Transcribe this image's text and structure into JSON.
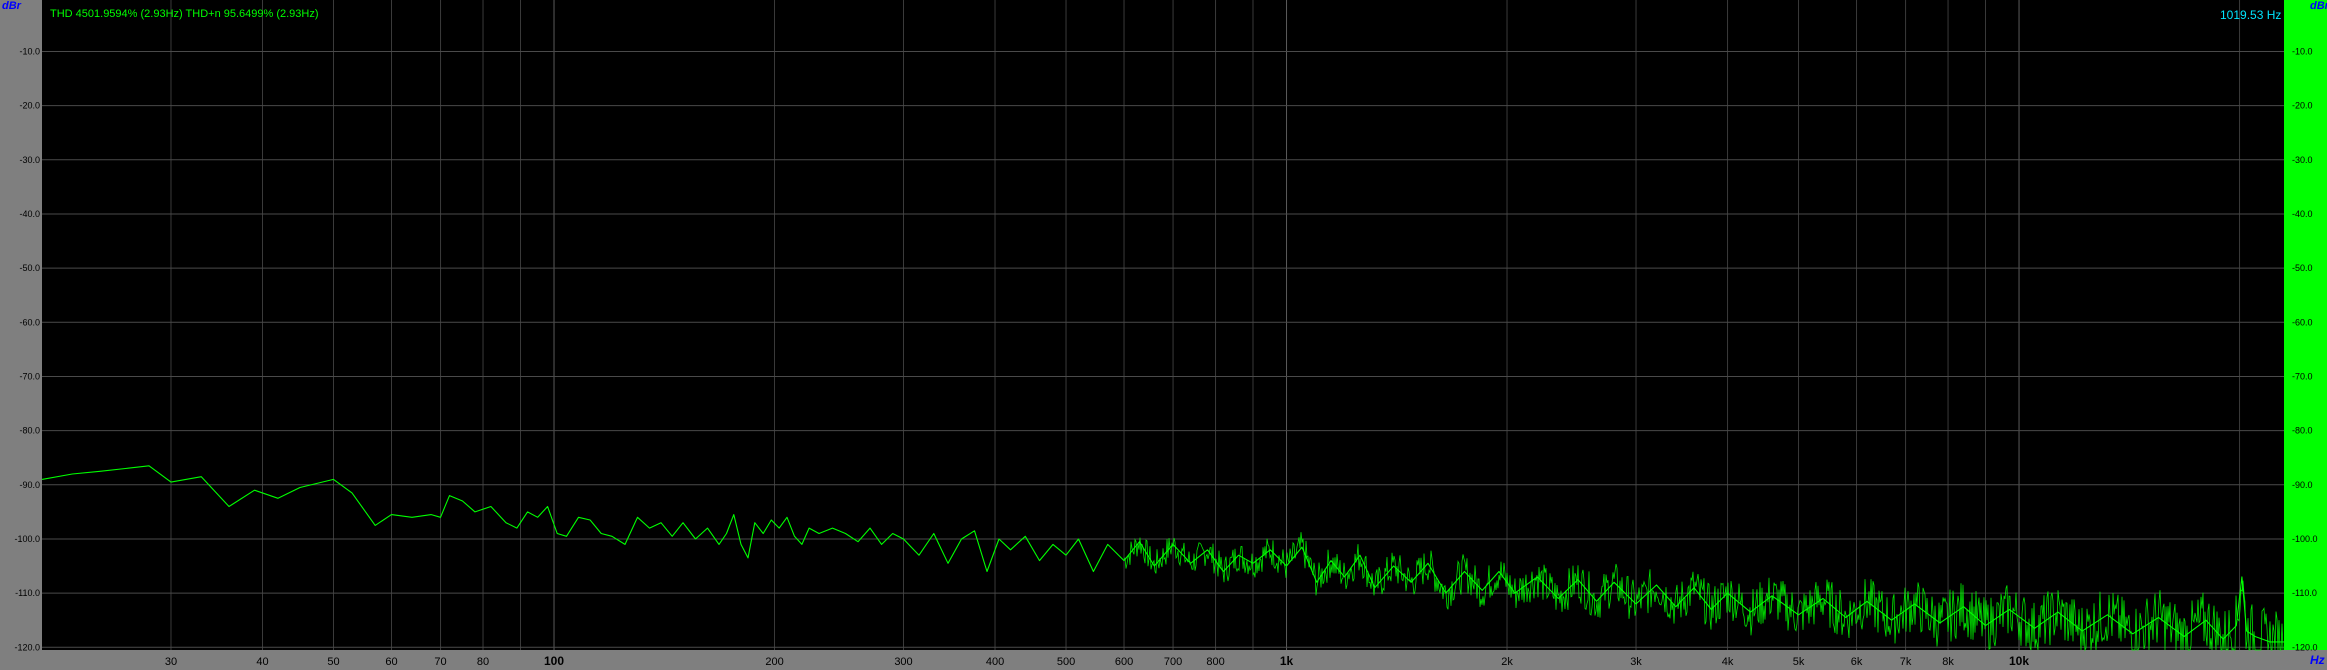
{
  "window": {
    "thd_readout": "THD 4501.9594% (2.93Hz) THD+n 95.6499% (2.93Hz)",
    "peak_readout": "1019.53 Hz",
    "y_unit_left": "dBr",
    "y_unit_right": "dBr",
    "x_unit": "Hz"
  },
  "colors": {
    "trace": "#00ff00",
    "plot_bg": "#000000",
    "frame": "#808080",
    "grid": "#3a3a3a",
    "readout_cyan": "#00e5ff",
    "unit_blue": "#0000ff"
  },
  "chart_data": {
    "type": "line",
    "x_scale": "log",
    "xlim": [
      20,
      23000
    ],
    "ylim": [
      -120.5,
      -0.5
    ],
    "grid": true,
    "y_ticks": [
      {
        "value": -10,
        "label": "-10.0"
      },
      {
        "value": -20,
        "label": "-20.0"
      },
      {
        "value": -30,
        "label": "-30.0"
      },
      {
        "value": -40,
        "label": "-40.0"
      },
      {
        "value": -50,
        "label": "-50.0"
      },
      {
        "value": -60,
        "label": "-60.0"
      },
      {
        "value": -70,
        "label": "-70.0"
      },
      {
        "value": -80,
        "label": "-80.0"
      },
      {
        "value": -90,
        "label": "-90.0"
      },
      {
        "value": -100,
        "label": "-100.0"
      },
      {
        "value": -110,
        "label": "-110.0"
      },
      {
        "value": -120,
        "label": "-120.0"
      }
    ],
    "x_ticks": [
      {
        "value": 30,
        "label": "30",
        "major": false
      },
      {
        "value": 40,
        "label": "40",
        "major": false
      },
      {
        "value": 50,
        "label": "50",
        "major": false
      },
      {
        "value": 60,
        "label": "60",
        "major": false
      },
      {
        "value": 70,
        "label": "70",
        "major": false
      },
      {
        "value": 80,
        "label": "80",
        "major": false
      },
      {
        "value": 100,
        "label": "100",
        "major": true
      },
      {
        "value": 200,
        "label": "200",
        "major": false
      },
      {
        "value": 300,
        "label": "300",
        "major": false
      },
      {
        "value": 400,
        "label": "400",
        "major": false
      },
      {
        "value": 500,
        "label": "500",
        "major": false
      },
      {
        "value": 600,
        "label": "600",
        "major": false
      },
      {
        "value": 700,
        "label": "700",
        "major": false
      },
      {
        "value": 800,
        "label": "800",
        "major": false
      },
      {
        "value": 1000,
        "label": "1k",
        "major": true
      },
      {
        "value": 2000,
        "label": "2k",
        "major": false
      },
      {
        "value": 3000,
        "label": "3k",
        "major": false
      },
      {
        "value": 4000,
        "label": "4k",
        "major": false
      },
      {
        "value": 5000,
        "label": "5k",
        "major": false
      },
      {
        "value": 6000,
        "label": "6k",
        "major": false
      },
      {
        "value": 7000,
        "label": "7k",
        "major": false
      },
      {
        "value": 8000,
        "label": "8k",
        "major": false
      },
      {
        "value": 10000,
        "label": "10k",
        "major": true
      }
    ],
    "minor_grid_x": [
      90,
      900,
      9000,
      20000
    ],
    "series": [
      {
        "points": [
          [
            20,
            -89
          ],
          [
            22,
            -88
          ],
          [
            24,
            -87.5
          ],
          [
            26,
            -87
          ],
          [
            28,
            -86.5
          ],
          [
            30,
            -89.5
          ],
          [
            33,
            -88.5
          ],
          [
            36,
            -94
          ],
          [
            39,
            -91
          ],
          [
            42,
            -92.5
          ],
          [
            45,
            -90.5
          ],
          [
            50,
            -89
          ],
          [
            53,
            -91.5
          ],
          [
            57,
            -97.5
          ],
          [
            60,
            -95.5
          ],
          [
            64,
            -96
          ],
          [
            68,
            -95.5
          ],
          [
            70,
            -96
          ],
          [
            72,
            -92
          ],
          [
            75,
            -93
          ],
          [
            78,
            -95
          ],
          [
            82,
            -94
          ],
          [
            86,
            -97
          ],
          [
            89,
            -98
          ],
          [
            92,
            -95
          ],
          [
            95,
            -96
          ],
          [
            98,
            -94
          ],
          [
            101,
            -99
          ],
          [
            104,
            -99.5
          ],
          [
            108,
            -96
          ],
          [
            112,
            -96.5
          ],
          [
            116,
            -99
          ],
          [
            120,
            -99.5
          ],
          [
            125,
            -101
          ],
          [
            130,
            -96
          ],
          [
            135,
            -98
          ],
          [
            140,
            -97
          ],
          [
            145,
            -99.5
          ],
          [
            150,
            -97
          ],
          [
            156,
            -100
          ],
          [
            162,
            -98
          ],
          [
            168,
            -101
          ],
          [
            172,
            -99
          ],
          [
            176,
            -95.5
          ],
          [
            180,
            -101
          ],
          [
            184,
            -103.5
          ],
          [
            188,
            -97
          ],
          [
            193,
            -99
          ],
          [
            198,
            -96.5
          ],
          [
            203,
            -98
          ],
          [
            208,
            -96
          ],
          [
            213,
            -99.5
          ],
          [
            218,
            -101
          ],
          [
            223,
            -98
          ],
          [
            230,
            -99
          ],
          [
            240,
            -98
          ],
          [
            250,
            -99
          ],
          [
            260,
            -100.5
          ],
          [
            270,
            -98
          ],
          [
            280,
            -101
          ],
          [
            290,
            -99
          ],
          [
            300,
            -100
          ],
          [
            315,
            -103
          ],
          [
            330,
            -99
          ],
          [
            345,
            -104.5
          ],
          [
            360,
            -100
          ],
          [
            375,
            -98.5
          ],
          [
            390,
            -106
          ],
          [
            405,
            -100
          ],
          [
            420,
            -102
          ],
          [
            440,
            -99.5
          ],
          [
            460,
            -104
          ],
          [
            480,
            -101
          ],
          [
            500,
            -103
          ],
          [
            520,
            -100
          ],
          [
            545,
            -106
          ],
          [
            570,
            -101
          ],
          [
            600,
            -104
          ],
          [
            630,
            -100.5
          ],
          [
            660,
            -105
          ],
          [
            700,
            -101
          ],
          [
            740,
            -104.5
          ],
          [
            780,
            -102
          ],
          [
            820,
            -106
          ],
          [
            860,
            -103
          ],
          [
            900,
            -104.5
          ],
          [
            950,
            -102
          ],
          [
            1000,
            -105
          ],
          [
            1050,
            -101.5
          ],
          [
            1100,
            -108
          ],
          [
            1150,
            -104
          ],
          [
            1200,
            -107
          ],
          [
            1260,
            -103
          ],
          [
            1320,
            -109
          ],
          [
            1400,
            -105
          ],
          [
            1480,
            -108
          ],
          [
            1560,
            -104.5
          ],
          [
            1650,
            -110
          ],
          [
            1750,
            -106
          ],
          [
            1850,
            -109.5
          ],
          [
            1950,
            -106
          ],
          [
            2050,
            -110
          ],
          [
            2200,
            -107
          ],
          [
            2350,
            -111
          ],
          [
            2500,
            -107.5
          ],
          [
            2650,
            -111.5
          ],
          [
            2800,
            -108
          ],
          [
            3000,
            -112
          ],
          [
            3200,
            -108.5
          ],
          [
            3400,
            -112.5
          ],
          [
            3600,
            -109
          ],
          [
            3800,
            -113
          ],
          [
            4000,
            -110
          ],
          [
            4300,
            -113.5
          ],
          [
            4600,
            -110.5
          ],
          [
            5000,
            -114
          ],
          [
            5400,
            -111
          ],
          [
            5800,
            -114.5
          ],
          [
            6200,
            -111.5
          ],
          [
            6700,
            -115
          ],
          [
            7200,
            -112
          ],
          [
            7800,
            -115.5
          ],
          [
            8400,
            -112.5
          ],
          [
            9000,
            -116
          ],
          [
            9700,
            -113
          ],
          [
            10500,
            -116.5
          ],
          [
            11300,
            -113.5
          ],
          [
            12200,
            -117
          ],
          [
            13200,
            -114
          ],
          [
            14300,
            -117.5
          ],
          [
            15500,
            -114.5
          ],
          [
            16800,
            -118
          ],
          [
            18000,
            -115
          ],
          [
            19000,
            -118.5
          ],
          [
            19800,
            -116
          ],
          [
            20150,
            -107
          ],
          [
            20450,
            -117
          ],
          [
            21000,
            -118
          ],
          [
            22000,
            -119
          ],
          [
            23000,
            -119
          ]
        ]
      }
    ]
  }
}
